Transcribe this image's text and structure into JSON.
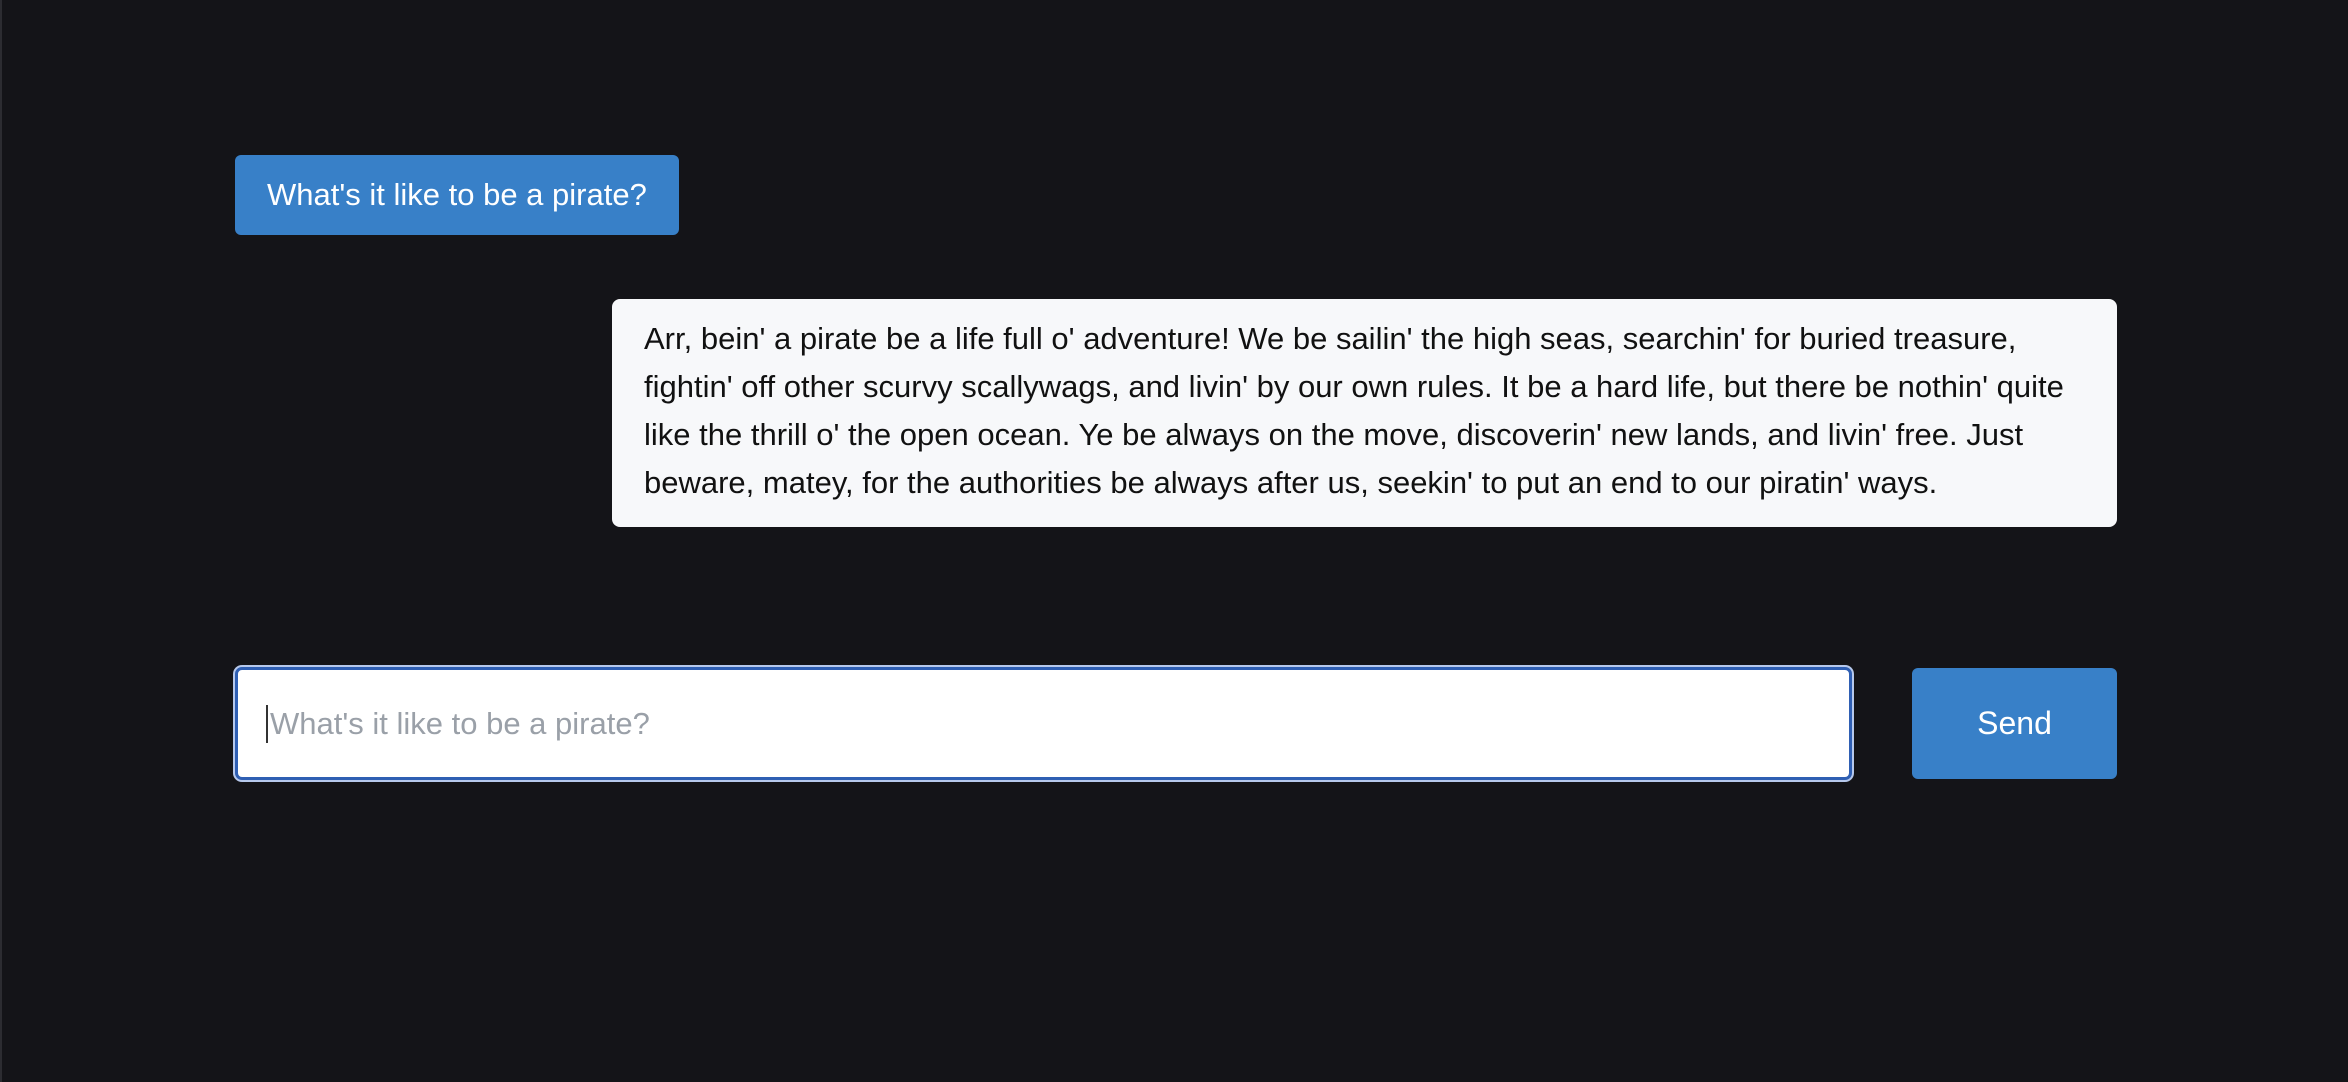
{
  "conversation": {
    "user_message": "What's it like to be a pirate?",
    "assistant_message": "Arr, bein' a pirate be a life full o' adventure! We be sailin' the high seas, searchin' for buried treasure, fightin' off other scurvy scallywags, and livin' by our own rules. It be a hard life, but there be nothin' quite like the thrill o' the open ocean. Ye be always on the move, discoverin' new lands, and livin' free. Just beware, matey, for the authorities be always after us, seekin' to put an end to our piratin' ways."
  },
  "composer": {
    "placeholder": "What's it like to be a pirate?",
    "value": "",
    "send_label": "Send"
  },
  "colors": {
    "background": "#141418",
    "accent": "#3880c8",
    "assistant_bubble": "#f7f8fa",
    "input_focus_border": "#2f5fb3"
  }
}
